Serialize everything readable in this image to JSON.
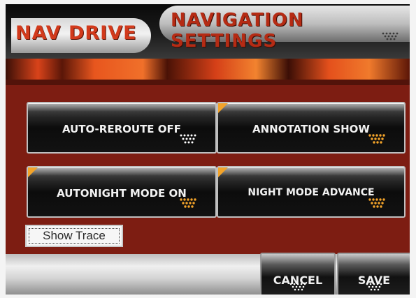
{
  "header": {
    "brand": "NAV DRIVE",
    "title": "NAVIGATION SETTINGS"
  },
  "options": [
    {
      "label": "AUTO-REROUTE OFF",
      "indicator_color": "#ffffff"
    },
    {
      "label": "ANNOTATION SHOW",
      "indicator_color": "#f2a32a"
    },
    {
      "label": "AUTONIGHT MODE ON",
      "indicator_color": "#f2a32a"
    },
    {
      "label": "NIGHT MODE ADVANCE",
      "indicator_color": "#f2a32a"
    }
  ],
  "trace_button": {
    "label": "Show Trace"
  },
  "footer": {
    "cancel_label": "CANCEL",
    "save_label": "SAVE"
  },
  "colors": {
    "background_red": "#7d1d12",
    "accent_orange": "#f2a32a",
    "title_red": "#b52b14"
  },
  "icons": {
    "arrow_indicator": "down-arrow-dots-icon"
  }
}
